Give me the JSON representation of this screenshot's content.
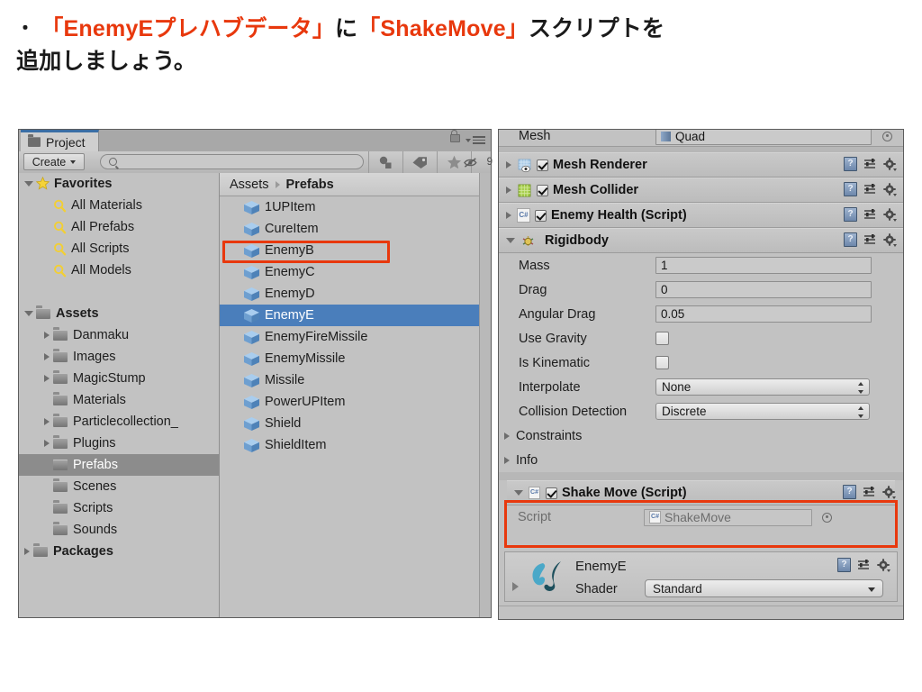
{
  "slide": {
    "bullet": "・",
    "line1_a": "「EnemyEプレハブデータ」",
    "line1_b": "に",
    "line1_c": "「ShakeMove」",
    "line1_d": "スクリプトを",
    "line2": "追加しましょう。",
    "highlight_color": "#e8380d"
  },
  "project": {
    "tab_label": "Project",
    "create_label": "Create",
    "search_value": "",
    "search_placeholder": "",
    "hidden_count": "9",
    "tree": [
      {
        "label": "Favorites",
        "indent": 0,
        "arrow": "open",
        "icon": "star",
        "bold": true,
        "selected": false
      },
      {
        "label": "All Materials",
        "indent": 1,
        "arrow": "none",
        "icon": "search",
        "bold": false,
        "selected": false
      },
      {
        "label": "All Prefabs",
        "indent": 1,
        "arrow": "none",
        "icon": "search",
        "bold": false,
        "selected": false
      },
      {
        "label": "All Scripts",
        "indent": 1,
        "arrow": "none",
        "icon": "search",
        "bold": false,
        "selected": false
      },
      {
        "label": "All Models",
        "indent": 1,
        "arrow": "none",
        "icon": "search",
        "bold": false,
        "selected": false
      },
      {
        "label": "",
        "indent": 0,
        "arrow": "none",
        "icon": "none",
        "bold": false,
        "selected": false
      },
      {
        "label": "Assets",
        "indent": 0,
        "arrow": "open",
        "icon": "folder",
        "bold": true,
        "selected": false
      },
      {
        "label": "Danmaku",
        "indent": 1,
        "arrow": "closed",
        "icon": "folder",
        "bold": false,
        "selected": false
      },
      {
        "label": "Images",
        "indent": 1,
        "arrow": "closed",
        "icon": "folder",
        "bold": false,
        "selected": false
      },
      {
        "label": "MagicStump",
        "indent": 1,
        "arrow": "closed",
        "icon": "folder",
        "bold": false,
        "selected": false
      },
      {
        "label": "Materials",
        "indent": 1,
        "arrow": "none",
        "icon": "folder",
        "bold": false,
        "selected": false
      },
      {
        "label": "Particlecollection_",
        "indent": 1,
        "arrow": "closed",
        "icon": "folder",
        "bold": false,
        "selected": false
      },
      {
        "label": "Plugins",
        "indent": 1,
        "arrow": "closed",
        "icon": "folder",
        "bold": false,
        "selected": false
      },
      {
        "label": "Prefabs",
        "indent": 1,
        "arrow": "none",
        "icon": "folder",
        "bold": false,
        "selected": true
      },
      {
        "label": "Scenes",
        "indent": 1,
        "arrow": "none",
        "icon": "folder",
        "bold": false,
        "selected": false
      },
      {
        "label": "Scripts",
        "indent": 1,
        "arrow": "none",
        "icon": "folder",
        "bold": false,
        "selected": false
      },
      {
        "label": "Sounds",
        "indent": 1,
        "arrow": "none",
        "icon": "folder",
        "bold": false,
        "selected": false
      },
      {
        "label": "Packages",
        "indent": 0,
        "arrow": "closed",
        "icon": "folder",
        "bold": true,
        "selected": false
      }
    ],
    "breadcrumb": {
      "root": "Assets",
      "current": "Prefabs"
    },
    "assets": [
      {
        "label": "1UPItem",
        "selected": false
      },
      {
        "label": "CureItem",
        "selected": false
      },
      {
        "label": "EnemyB",
        "selected": false
      },
      {
        "label": "EnemyC",
        "selected": false
      },
      {
        "label": "EnemyD",
        "selected": false
      },
      {
        "label": "EnemyE",
        "selected": true
      },
      {
        "label": "EnemyFireMissile",
        "selected": false
      },
      {
        "label": "EnemyMissile",
        "selected": false
      },
      {
        "label": "Missile",
        "selected": false
      },
      {
        "label": "PowerUPItem",
        "selected": false
      },
      {
        "label": "Shield",
        "selected": false
      },
      {
        "label": "ShieldItem",
        "selected": false
      }
    ]
  },
  "inspector": {
    "mesh_row": {
      "label": "Mesh",
      "value": "Quad"
    },
    "components": [
      {
        "name": "Mesh Renderer",
        "icon": "mesh-renderer-icon",
        "checkbox": true,
        "checked": true,
        "expanded": false
      },
      {
        "name": "Mesh Collider",
        "icon": "mesh-collider-icon",
        "checkbox": true,
        "checked": true,
        "expanded": false
      },
      {
        "name": "Enemy Health (Script)",
        "icon": "csharp-icon",
        "checkbox": true,
        "checked": true,
        "expanded": false
      }
    ],
    "rigidbody": {
      "name": "Rigidbody",
      "icon": "rigidbody-icon",
      "expanded": true,
      "props": [
        {
          "label": "Mass",
          "type": "field",
          "value": "1"
        },
        {
          "label": "Drag",
          "type": "field",
          "value": "0"
        },
        {
          "label": "Angular Drag",
          "type": "field",
          "value": "0.05"
        },
        {
          "label": "Use Gravity",
          "type": "checkbox",
          "value": false
        },
        {
          "label": "Is Kinematic",
          "type": "checkbox",
          "value": false
        },
        {
          "label": "Interpolate",
          "type": "dropdown",
          "value": "None"
        },
        {
          "label": "Collision Detection",
          "type": "dropdown",
          "value": "Discrete"
        }
      ],
      "foldouts": [
        "Constraints",
        "Info"
      ]
    },
    "shake_move": {
      "name": "Shake Move (Script)",
      "icon": "csharp-icon",
      "checked": true,
      "expanded": true,
      "script_label": "Script",
      "script_value": "ShakeMove",
      "highlight_color": "#e8380d"
    },
    "material": {
      "name": "EnemyE",
      "shader_label": "Shader",
      "shader_value": "Standard",
      "icon": "material-icon"
    }
  },
  "colors": {
    "accent_red": "#e8380d",
    "selection_blue": "#4a7ebb",
    "panel_gray": "#c2c2c2",
    "tab_blue": "#3a6ea5"
  }
}
